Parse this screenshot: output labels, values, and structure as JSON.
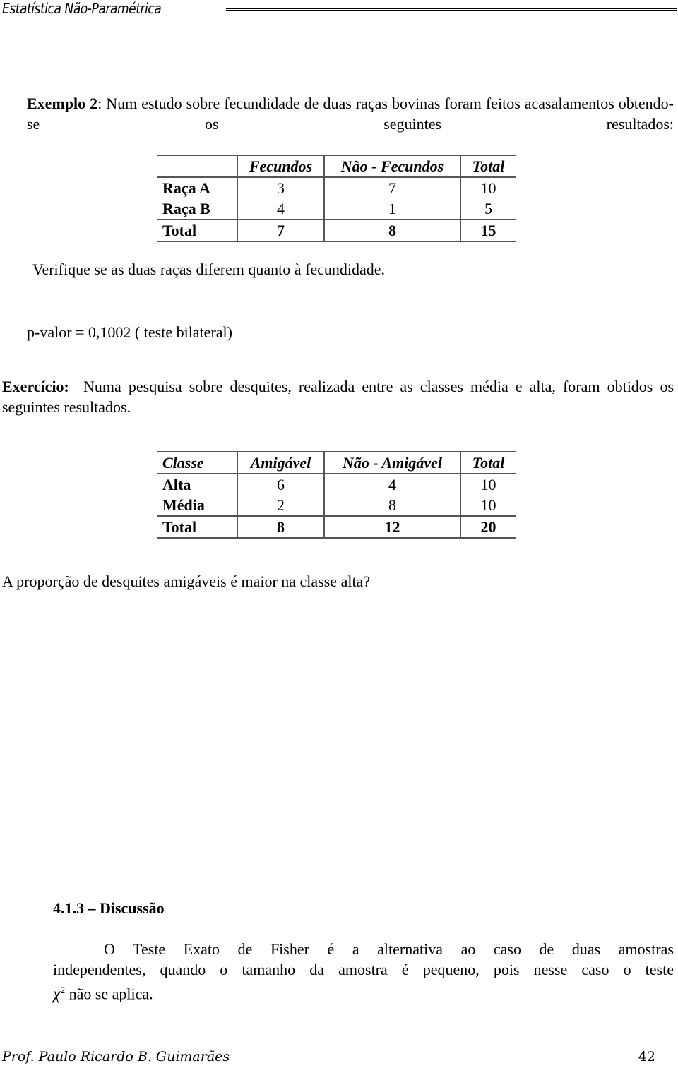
{
  "header": {
    "title": "Estatística Não-Paramétrica"
  },
  "example2": {
    "label": "Exemplo 2",
    "text": ": Num estudo sobre fecundidade de duas raças bovinas foram feitos acasalamentos obtendo-se os seguintes resultados:"
  },
  "table1": {
    "headers": [
      "",
      "Fecundos",
      "Não - Fecundos",
      "Total"
    ],
    "rows": [
      {
        "label": "Raça A",
        "values": [
          "3",
          "7",
          "10"
        ]
      },
      {
        "label": "Raça B",
        "values": [
          "4",
          "1",
          "5"
        ]
      }
    ],
    "total": {
      "label": "Total",
      "values": [
        "7",
        "8",
        "15"
      ]
    }
  },
  "question1": "Verifique se as duas raças diferem quanto à fecundidade.",
  "pvalue": "p-valor = 0,1002 ( teste bilateral)",
  "exercise": {
    "label": "Exercício:",
    "text": "Numa pesquisa sobre desquites, realizada entre as classes média e alta, foram obtidos os seguintes resultados."
  },
  "table2": {
    "headers": [
      "Classe",
      "Amigável",
      "Não - Amigável",
      "Total"
    ],
    "rows": [
      {
        "label": "Alta",
        "values": [
          "6",
          "4",
          "10"
        ]
      },
      {
        "label": "Média",
        "values": [
          "2",
          "8",
          "10"
        ]
      }
    ],
    "total": {
      "label": "Total",
      "values": [
        "8",
        "12",
        "20"
      ]
    }
  },
  "question2": "A proporção de desquites amigáveis é maior na classe alta?",
  "section": {
    "heading": "4.1.3 – Discussão",
    "line1": "O Teste Exato de Fisher é a alternativa ao caso de duas amostras",
    "line2": "independentes, quando o tamanho da amostra é pequeno, pois nesse caso o teste",
    "chi_symbol": "χ",
    "chi_exp": "2",
    "line3": " não se aplica."
  },
  "footer": {
    "author": "Prof. Paulo Ricardo B. Guimarães",
    "page": "42"
  }
}
